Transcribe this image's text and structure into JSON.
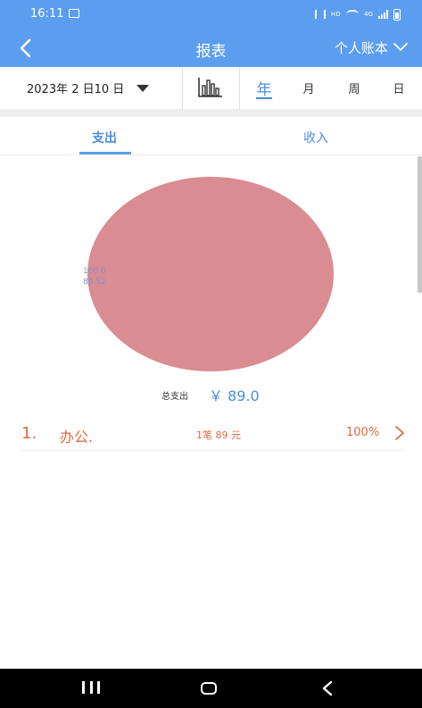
{
  "status_bar": {
    "time": "16:11",
    "icons": [
      "image-icon",
      "mute-icon",
      "hd-icon",
      "wifi-icon",
      "4g-icon",
      "signal-icon",
      "battery-icon"
    ],
    "hd_text": "HD",
    "network_text": "4G"
  },
  "app_bar": {
    "title": "报表",
    "account_label": "个人账本",
    "icons": [
      "back-arrow-icon",
      "chevron-down-icon"
    ]
  },
  "filter": {
    "date_label": "2023年 2 日10 日",
    "periods": [
      {
        "label": "年",
        "active": true
      },
      {
        "label": "月",
        "active": false
      },
      {
        "label": "周",
        "active": false
      },
      {
        "label": "日",
        "active": false
      }
    ],
    "icons": [
      "caret-down-icon",
      "bar-chart-icon"
    ]
  },
  "type_tabs": [
    {
      "label": "支出",
      "active": true
    },
    {
      "label": "收入",
      "active": false
    }
  ],
  "chart_data": {
    "type": "pie",
    "slices": [
      {
        "label": "办公.",
        "value": 89.0,
        "percent": 100.0,
        "color": "#d98c92"
      }
    ],
    "value_label_line1": "100.0",
    "value_label_line2": "89.52"
  },
  "summary": {
    "total_label": "总支出",
    "total_value": "￥ 89.0"
  },
  "categories": [
    {
      "index": "1.",
      "name": "办公.",
      "count": "1笔 89 元",
      "percent": "100%"
    }
  ],
  "colors": {
    "primary": "#5b9ef0",
    "accent_text": "#4a8de0",
    "category_text": "#e06a3f",
    "pie_slice": "#d98c92"
  },
  "nav_bar": {
    "icons": [
      "recents-icon",
      "home-icon",
      "back-icon"
    ]
  }
}
